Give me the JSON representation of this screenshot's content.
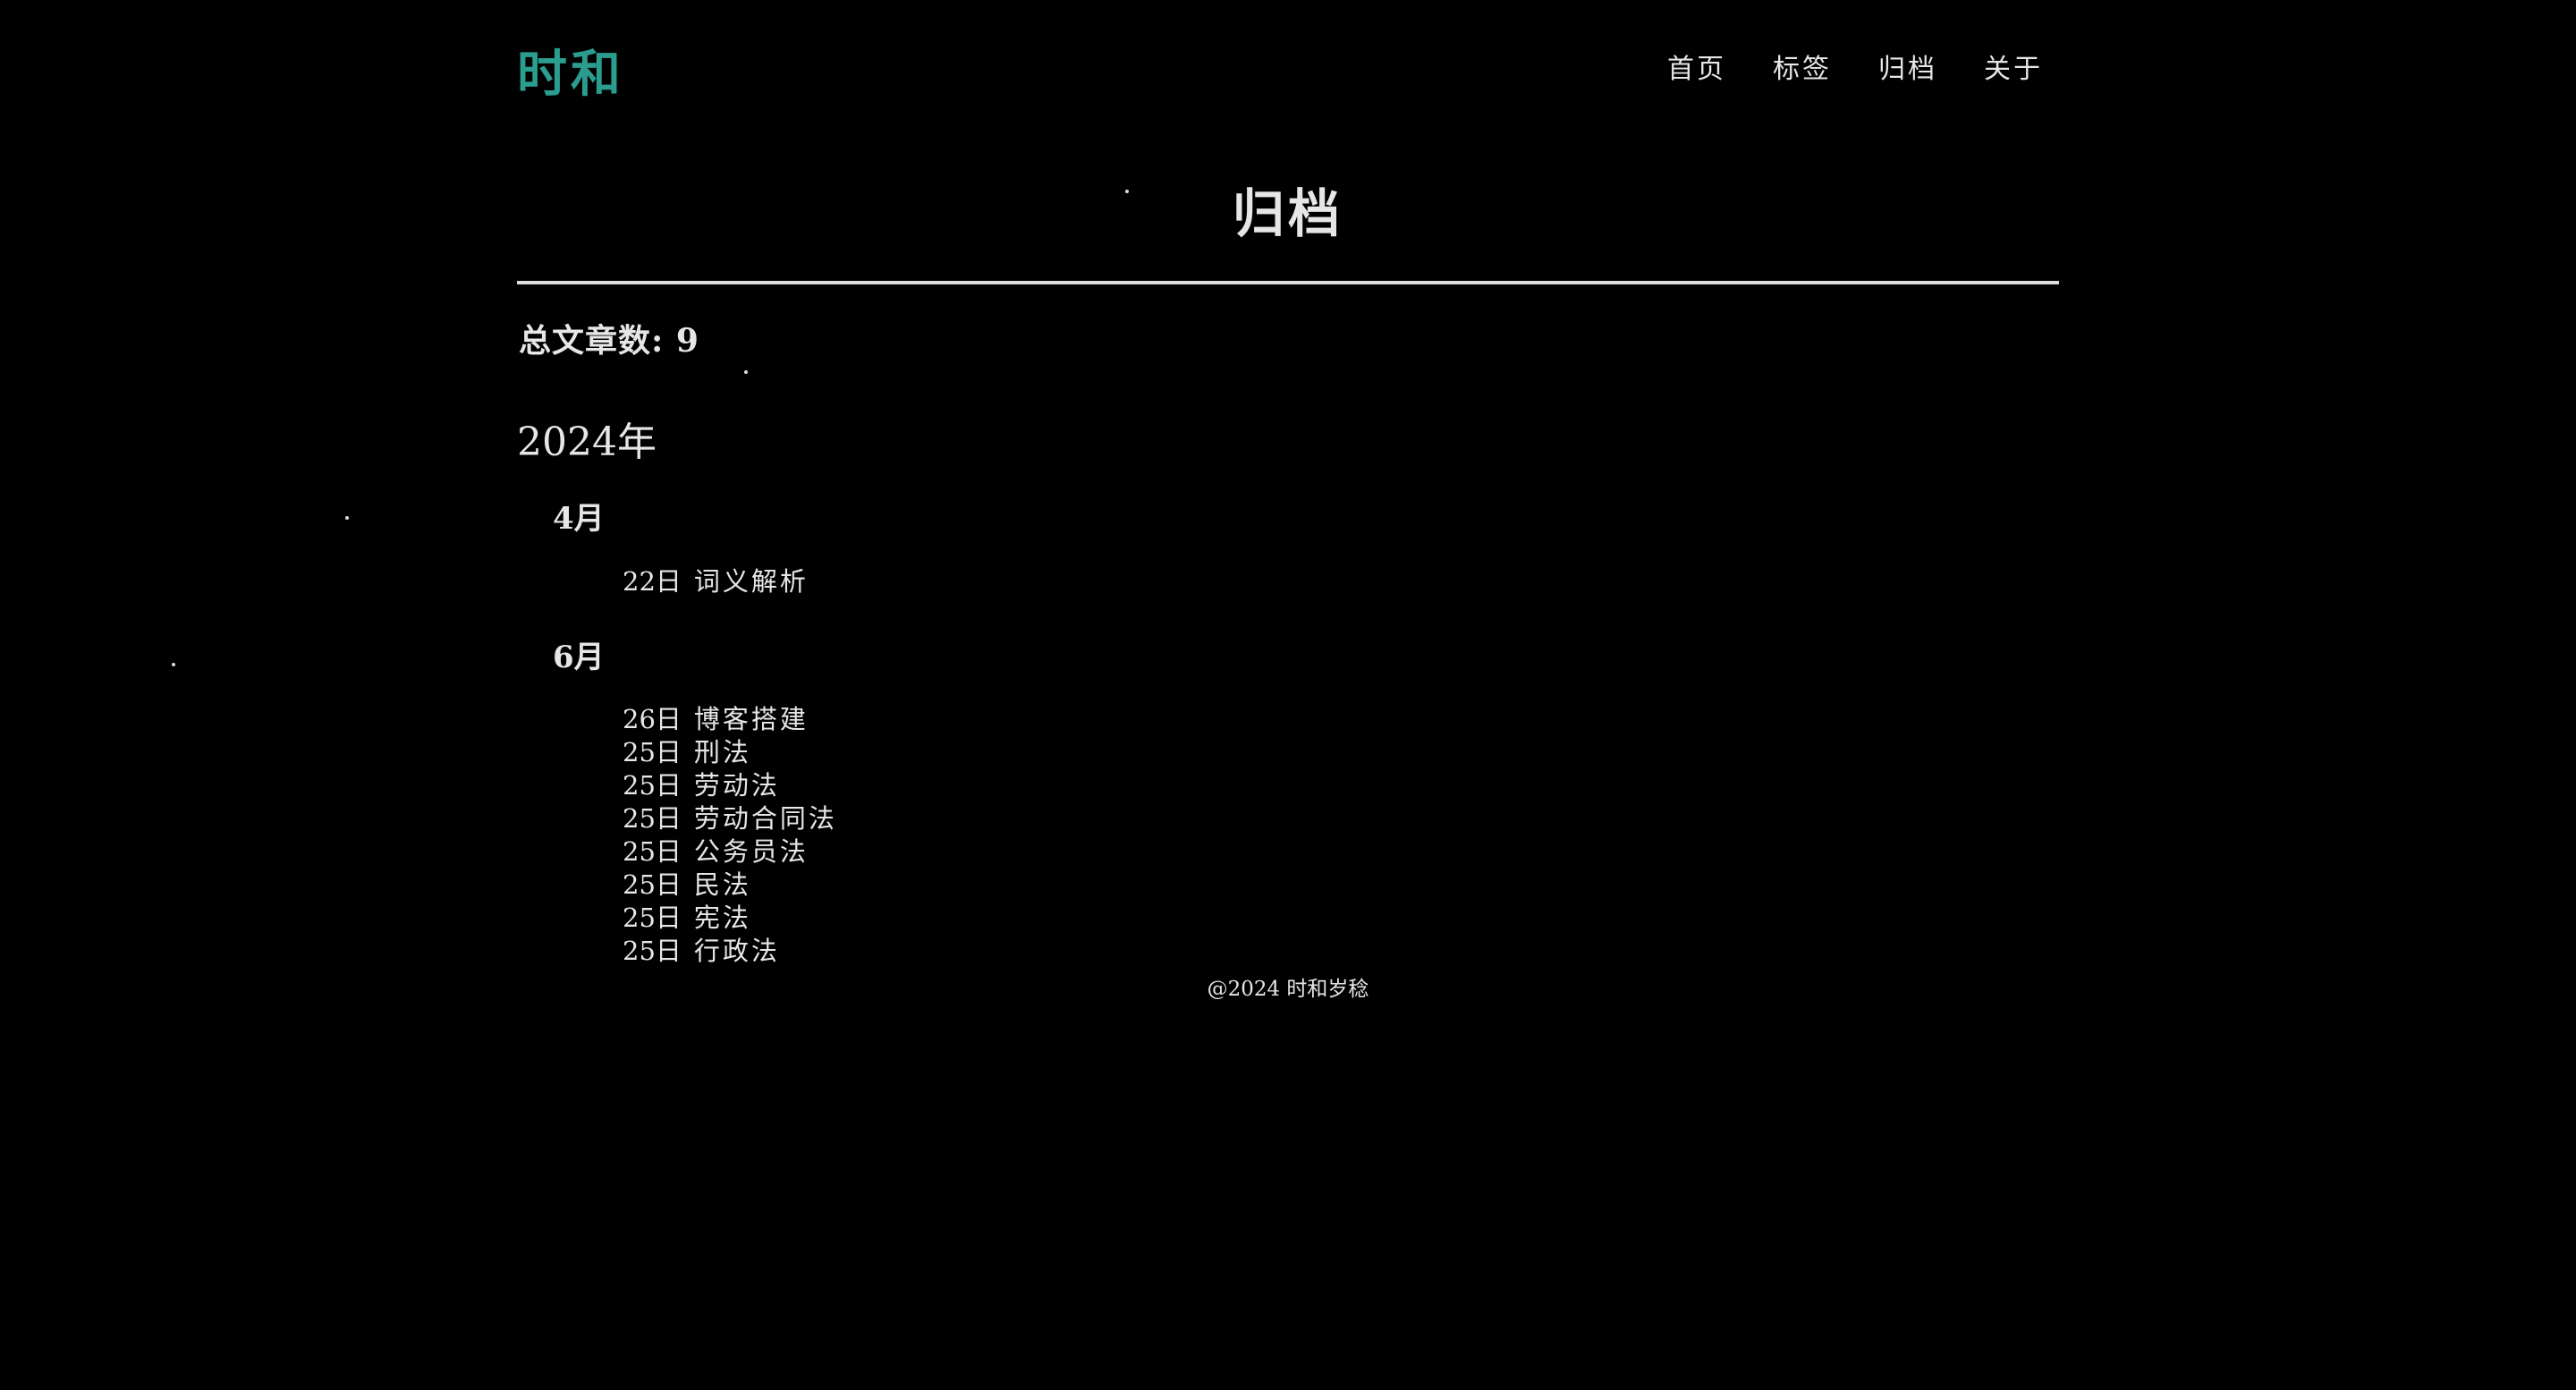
{
  "header": {
    "logo": "时和",
    "nav": [
      "首页",
      "标签",
      "归档",
      "关于"
    ]
  },
  "main": {
    "title": "归档",
    "total_label": "总文章数: 9",
    "year": "2024年",
    "months": [
      {
        "label": "4月",
        "posts": [
          {
            "day": "22日",
            "title": "词义解析"
          }
        ]
      },
      {
        "label": "6月",
        "posts": [
          {
            "day": "26日",
            "title": "博客搭建"
          },
          {
            "day": "25日",
            "title": "刑法"
          },
          {
            "day": "25日",
            "title": "劳动法"
          },
          {
            "day": "25日",
            "title": "劳动合同法"
          },
          {
            "day": "25日",
            "title": "公务员法"
          },
          {
            "day": "25日",
            "title": "民法"
          },
          {
            "day": "25日",
            "title": "宪法"
          },
          {
            "day": "25日",
            "title": "行政法"
          }
        ]
      }
    ]
  },
  "footer": {
    "text": "@2024 时和岁稔"
  },
  "colors": {
    "background": "#000000",
    "text": "#e6e6e6",
    "logo_accent": "#2a9d8f"
  }
}
